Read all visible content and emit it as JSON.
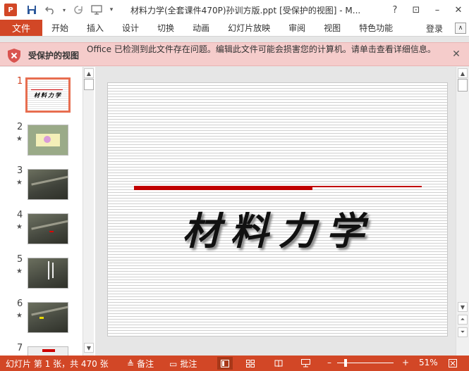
{
  "titlebar": {
    "app_icon": "P",
    "title": "材料力学(全套课件470P)孙训方版.ppt [受保护的视图] - M...",
    "help": "?",
    "restore": "⊡",
    "minimize": "–",
    "close": "✕"
  },
  "ribbon": {
    "file_tab": "文件",
    "tabs": [
      "开始",
      "插入",
      "设计",
      "切换",
      "动画",
      "幻灯片放映",
      "审阅",
      "视图",
      "特色功能"
    ],
    "login": "登录",
    "collapse": "∧"
  },
  "protected_view": {
    "title": "受保护的视图",
    "message": "Office 已检测到此文件存在问题。编辑此文件可能会损害您的计算机。请单击查看详细信息。",
    "close": "✕"
  },
  "thumbnails": [
    {
      "num": "1",
      "star": "",
      "selected": true
    },
    {
      "num": "2",
      "star": "★",
      "selected": false
    },
    {
      "num": "3",
      "star": "★",
      "selected": false
    },
    {
      "num": "4",
      "star": "★",
      "selected": false
    },
    {
      "num": "5",
      "star": "★",
      "selected": false
    },
    {
      "num": "6",
      "star": "★",
      "selected": false
    },
    {
      "num": "7",
      "star": "",
      "selected": false
    }
  ],
  "thumb1_text": "材料力学",
  "slide": {
    "title": "材料力学"
  },
  "statusbar": {
    "slide_info": "幻灯片 第 1 张，共 470 张",
    "notes": "备注",
    "comments": "批注",
    "zoom_minus": "–",
    "zoom_plus": "+",
    "zoom": "51%"
  },
  "colors": {
    "accent": "#d24726",
    "protected_bg": "#f5cccb"
  }
}
